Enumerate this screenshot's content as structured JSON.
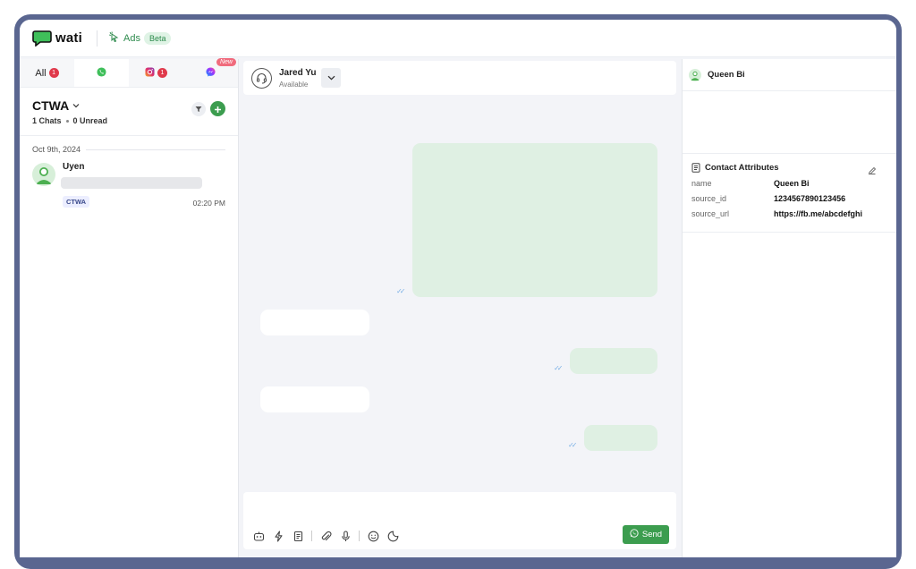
{
  "brand": {
    "name": "wati"
  },
  "topnav": {
    "ads_label": "Ads",
    "beta_label": "Beta"
  },
  "channels": {
    "all_label": "All",
    "all_count": "1",
    "instagram_count": "1",
    "messenger_new": "New"
  },
  "inbox": {
    "title": "CTWA",
    "chats": "1 Chats",
    "unread": "0 Unread",
    "date": "Oct 9th, 2024",
    "items": [
      {
        "name": "Uyen",
        "tag": "CTWA",
        "time": "02:20 PM"
      }
    ]
  },
  "conversation": {
    "agent_name": "Jared Yu",
    "agent_status": "Available",
    "send_label": "Send"
  },
  "contact": {
    "name": "Queen Bi",
    "attributes_title": "Contact Attributes",
    "attributes": [
      {
        "key": "name",
        "value": "Queen Bi"
      },
      {
        "key": "source_id",
        "value": "1234567890123456"
      },
      {
        "key": "source_url",
        "value": "https://fb.me/abcdefghi"
      }
    ]
  },
  "colors": {
    "accent": "#3c9d4f",
    "frame": "#5a6690",
    "outgoing_bubble": "#dff0e3",
    "badge": "#e0394b"
  }
}
